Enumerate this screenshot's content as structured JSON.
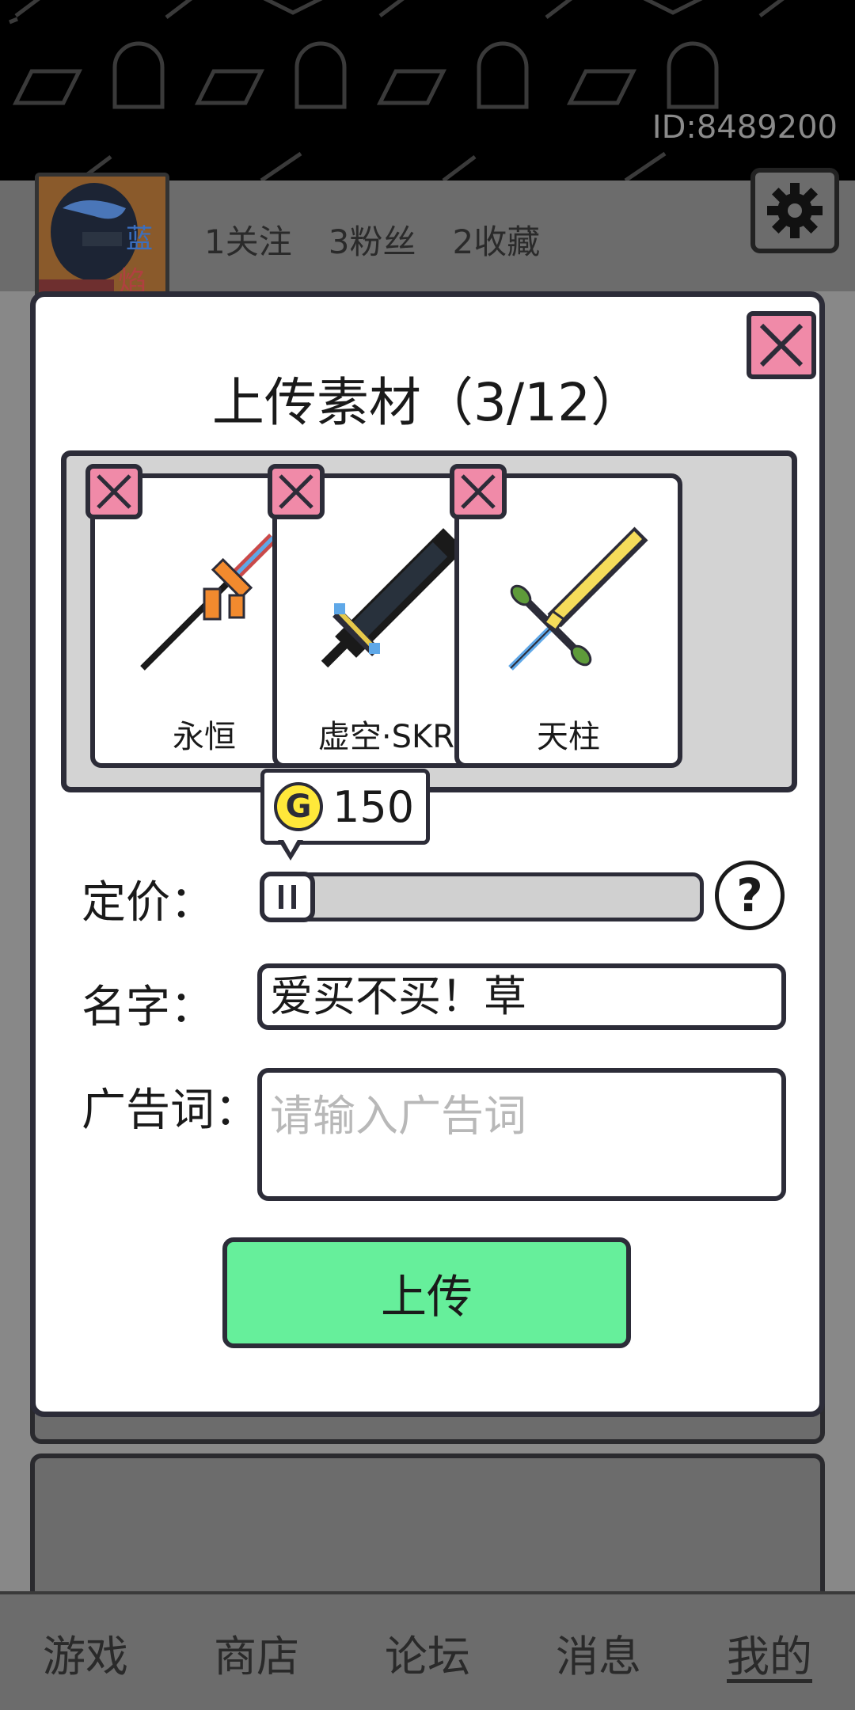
{
  "header": {
    "user_id": "ID:8489200"
  },
  "profile": {
    "avatar_icon": "avatar",
    "stats": [
      {
        "label": "1关注"
      },
      {
        "label": "3粉丝"
      },
      {
        "label": "2收藏"
      }
    ],
    "settings_icon": "gear-icon"
  },
  "modal": {
    "title": "上传素材（3/12）",
    "close_icon": "close-icon",
    "items": [
      {
        "name": "永恒",
        "icon": "spear-icon"
      },
      {
        "name": "虚空·SKR",
        "icon": "dark-sword-icon"
      },
      {
        "name": "天柱",
        "icon": "golden-sword-icon"
      }
    ],
    "price": {
      "label": "定价：",
      "value": "150",
      "coin_symbol": "G",
      "help_symbol": "?"
    },
    "name_field": {
      "label": "名字：",
      "value": "爱买不买！草"
    },
    "ad_field": {
      "label": "广告词：",
      "placeholder": "请输入广告词",
      "value": ""
    },
    "upload_label": "上传"
  },
  "bottom_nav": [
    {
      "label": "游戏",
      "active": false
    },
    {
      "label": "商店",
      "active": false
    },
    {
      "label": "论坛",
      "active": false
    },
    {
      "label": "消息",
      "active": false
    },
    {
      "label": "我的",
      "active": true
    }
  ],
  "colors": {
    "accent_green": "#66ef9b",
    "close_pink": "#f08aa8",
    "coin_yellow": "#ffe83a",
    "outline": "#2c2c38"
  }
}
